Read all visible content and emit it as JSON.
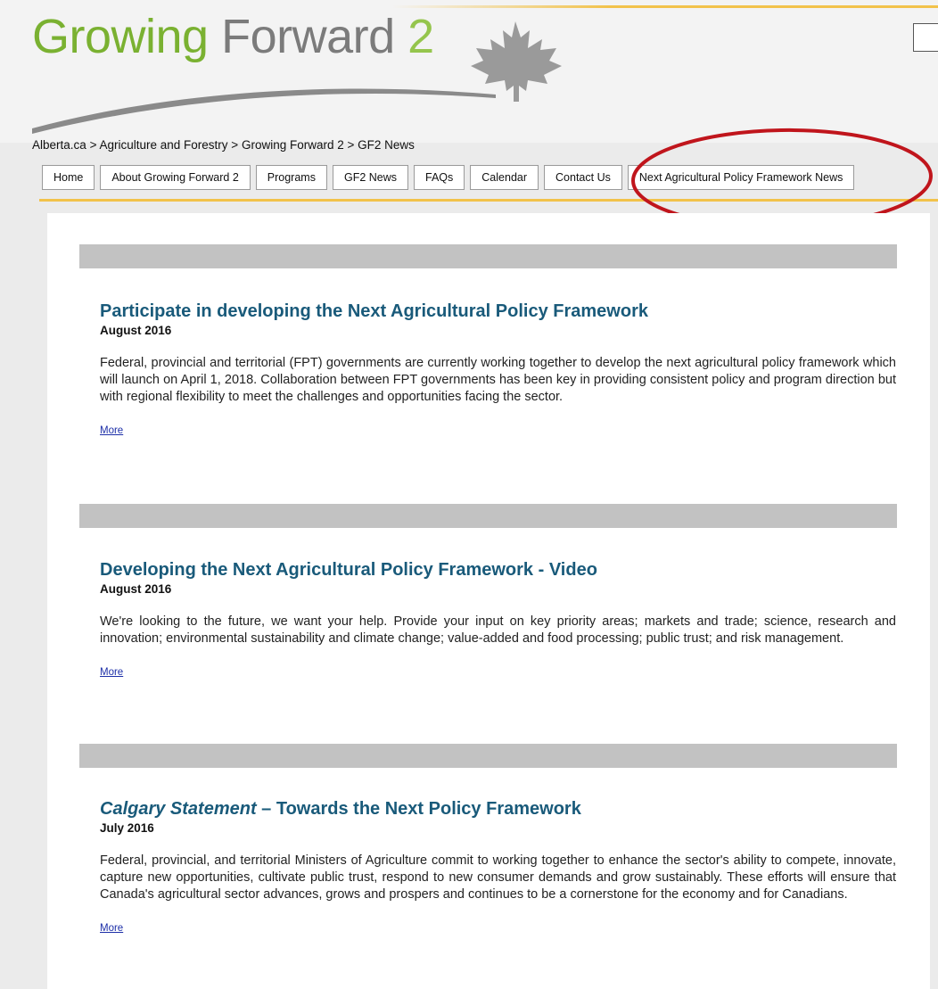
{
  "header": {
    "logo": {
      "word1": "Growing",
      "word2": "Forward",
      "number": "2"
    }
  },
  "breadcrumb": {
    "items": [
      "Alberta.ca",
      "Agriculture and Forestry",
      "Growing Forward 2",
      "GF2 News"
    ],
    "separator": ">"
  },
  "nav": {
    "tabs": [
      {
        "label": "Home"
      },
      {
        "label": "About Growing Forward 2"
      },
      {
        "label": "Programs"
      },
      {
        "label": "GF2 News"
      },
      {
        "label": "FAQs"
      },
      {
        "label": "Calendar"
      },
      {
        "label": "Contact Us"
      },
      {
        "label": "Next Agricultural Policy Framework News"
      }
    ]
  },
  "annotation_color": "#c0151c",
  "brand_colors": {
    "green": "#7ab131",
    "gray": "#7b7b7b",
    "accent": "#f2c24a",
    "title": "#195a7a"
  },
  "articles": [
    {
      "title_italic": "",
      "title": "Participate in developing the Next Agricultural Policy Framework",
      "date": "August 2016",
      "body": "Federal, provincial and territorial (FPT) governments are currently working together to develop the next agricultural policy framework which will launch on April 1, 2018. Collaboration between FPT governments has been key in providing consistent policy and program direction but with regional flexibility to meet the challenges and opportunities facing the sector.",
      "more": "More"
    },
    {
      "title_italic": "",
      "title": "Developing the Next Agricultural Policy Framework - Video",
      "date": "August 2016",
      "body": "We're looking to the future, we want your help. Provide your input on key priority areas; markets and trade; science, research and innovation; environmental sustainability and climate change; value-added and food processing; public trust; and risk management.",
      "more": "More"
    },
    {
      "title_italic": "Calgary Statement",
      "title": " – Towards the Next Policy Framework",
      "date": "July 2016",
      "body": "Federal, provincial, and territorial Ministers of Agriculture commit to working together to enhance the sector's ability to compete, innovate, capture new opportunities, cultivate public trust, respond to new consumer demands and grow sustainably. These efforts will ensure that Canada's agricultural sector advances, grows and prospers and continues to be a cornerstone for the economy and for Canadians.",
      "more": "More"
    }
  ]
}
